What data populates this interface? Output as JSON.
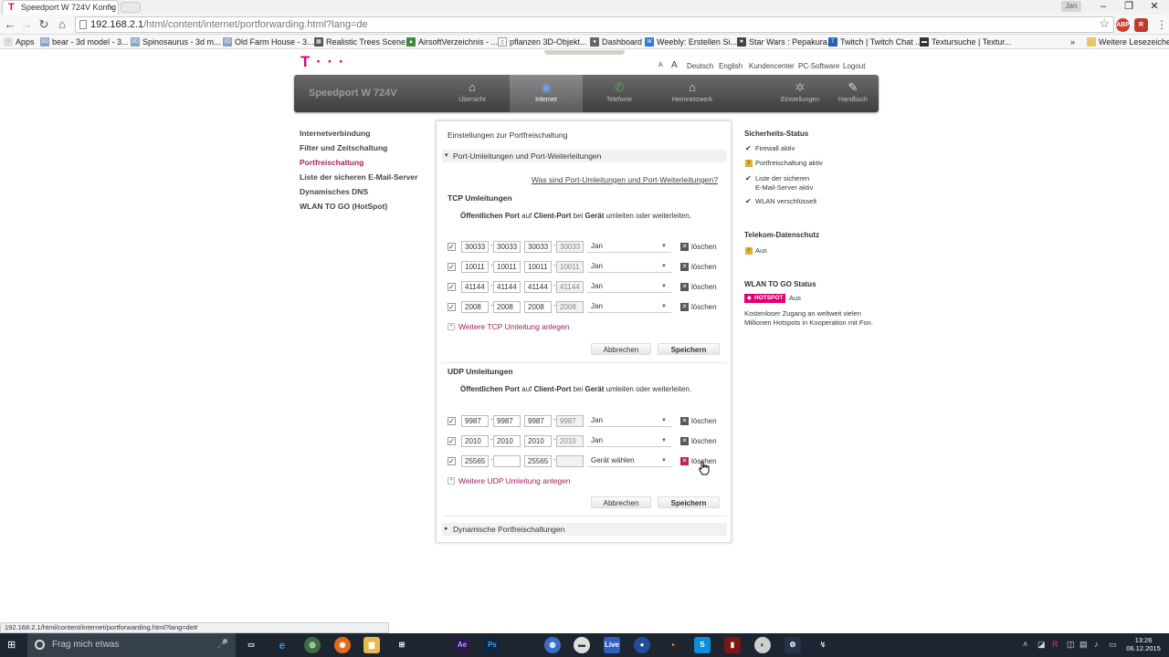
{
  "browser": {
    "tab_title": "Speedport W 724V Konfig",
    "tab_close": "×",
    "user_badge": "Jan",
    "url_host": "192.168.2.1",
    "url_path": "/html/content/internet/portforwarding.html?lang=de",
    "bookmarks": [
      "Apps",
      "bear - 3d model - 3...",
      "Spinosaurus - 3d m...",
      "Old Farm House - 3...",
      "Realistic Trees Scene...",
      "AirsoftVerzeichnis - ...",
      "pflanzen 3D-Objekt...",
      "Dashboard",
      "Weebly: Erstellen Si...",
      "Star Wars : Pepakura...",
      "Twitch | Twitch Chat ...",
      "Textursuche | Textur..."
    ],
    "bookmarks_more": "»",
    "other_bookmarks": "Weitere Lesezeichen",
    "status_url": "192.168.2.1/html/content/internet/portforwarding.html?lang=de#"
  },
  "router": {
    "logo": "T · · ·",
    "topnav": [
      "A",
      "A",
      "Deutsch",
      "English",
      "Kundencenter",
      "PC-Software",
      "Logout"
    ],
    "brand": "Speedport W 724V",
    "nav": [
      {
        "label": "Übersicht",
        "icon": "home-icon",
        "glyph": "⌂"
      },
      {
        "label": "Internet",
        "icon": "globe-icon",
        "glyph": "◉"
      },
      {
        "label": "Telefonie",
        "icon": "phone-icon",
        "glyph": "✆"
      },
      {
        "label": "Heimnetzwerk",
        "icon": "house-network-icon",
        "glyph": "⌂"
      },
      {
        "label": "Einstellungen",
        "icon": "gear-icon",
        "glyph": "✲"
      },
      {
        "label": "Handbuch",
        "icon": "book-icon",
        "glyph": "✎"
      }
    ],
    "sidenav": [
      "Internetverbindung",
      "Filter und Zeitschaltung",
      "Portfreischaltung",
      "Liste der sicheren E-Mail-Server",
      "Dynamisches DNS",
      "WLAN TO GO (HotSpot)"
    ],
    "panel_title": "Einstellungen zur Portfreischaltung",
    "section1": "Port-Umleitungen und Port-Weiterleitungen",
    "help_link": "Was sind Port-Umleitungen und Port-Weiterleitungen?",
    "tcp": {
      "heading": "TCP Umleitungen",
      "intro_bold1": "Öffentlichen Port",
      "intro_mid1": " auf ",
      "intro_bold2": "Client-Port",
      "intro_mid2": " bei ",
      "intro_bold3": "Gerät",
      "intro_end": " umleiten oder weiterleiten.",
      "rows": [
        {
          "p1": "30033",
          "p2": "30033",
          "c1": "30033",
          "c2": "30033",
          "device": "Jan",
          "delete": "löschen"
        },
        {
          "p1": "10011",
          "p2": "10011",
          "c1": "10011",
          "c2": "10011",
          "device": "Jan",
          "delete": "löschen"
        },
        {
          "p1": "41144",
          "p2": "41144",
          "c1": "41144",
          "c2": "41144",
          "device": "Jan",
          "delete": "löschen"
        },
        {
          "p1": "2008",
          "p2": "2008",
          "c1": "2008",
          "c2": "2008",
          "device": "Jan",
          "delete": "löschen"
        }
      ],
      "add": "Weitere TCP Umleitung anlegen",
      "cancel": "Abbrechen",
      "save": "Speichern"
    },
    "udp": {
      "heading": "UDP Umleitungen",
      "intro_bold1": "Öffentlichen Port",
      "intro_mid1": " auf ",
      "intro_bold2": "Client-Port",
      "intro_mid2": " bei ",
      "intro_bold3": "Gerät",
      "intro_end": " umleiten oder weiterleiten.",
      "rows": [
        {
          "p1": "9987",
          "p2": "9987",
          "c1": "9987",
          "c2": "9987",
          "device": "Jan",
          "delete": "löschen"
        },
        {
          "p1": "2010",
          "p2": "2010",
          "c1": "2010",
          "c2": "2010",
          "device": "Jan",
          "delete": "löschen"
        },
        {
          "p1": "25565",
          "p2": "",
          "c1": "25565",
          "c2": "",
          "device": "Gerät wählen",
          "delete": "löschen"
        }
      ],
      "add": "Weitere UDP Umleitung anlegen",
      "cancel": "Abbrechen",
      "save": "Speichern"
    },
    "section2": "Dynamische Portfreischaltungen",
    "security": {
      "heading": "Sicherheits-Status",
      "items": [
        "Firewall aktiv",
        "Portfreischaltung aktiv",
        "Liste der sicheren",
        "E-Mail-Server aktiv",
        "WLAN verschlüsselt"
      ]
    },
    "privacy": {
      "heading": "Telekom-Datenschutz",
      "value": "Aus"
    },
    "wlan_to_go": {
      "heading": "WLAN TO GO Status",
      "badge": "HOTSPOT",
      "value": "Aus",
      "text": "Kostenloser Zugang an weltweit vielen Millionen Hotspots in Kooperation mit Fon."
    }
  },
  "taskbar": {
    "search_placeholder": "Frag mich etwas",
    "time": "13:26",
    "date": "06.12.2015"
  }
}
